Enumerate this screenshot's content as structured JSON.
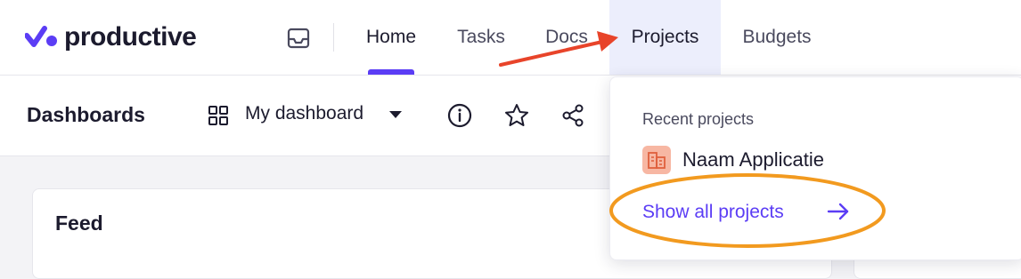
{
  "app": {
    "logo_text": "productive"
  },
  "nav": {
    "items": [
      {
        "label": "Home"
      },
      {
        "label": "Tasks"
      },
      {
        "label": "Docs"
      },
      {
        "label": "Projects"
      },
      {
        "label": "Budgets"
      }
    ]
  },
  "toolbar": {
    "title": "Dashboards",
    "dashboard_select": "My dashboard"
  },
  "main": {
    "feed_title": "Feed"
  },
  "projects_dropdown": {
    "header": "Recent projects",
    "recent": [
      {
        "name": "Naam Applicatie"
      }
    ],
    "show_all_label": "Show all projects"
  },
  "icons": [
    "logo-icon",
    "inbox-icon",
    "grid-icon",
    "caret-down-icon",
    "info-icon",
    "star-icon",
    "share-icon",
    "building-icon",
    "arrow-right-icon"
  ],
  "colors": {
    "accent": "#5b3df5",
    "annotation_arrow": "#e8442a",
    "annotation_ellipse": "#f29a1f",
    "project_icon_bg": "#f7b7a3"
  }
}
